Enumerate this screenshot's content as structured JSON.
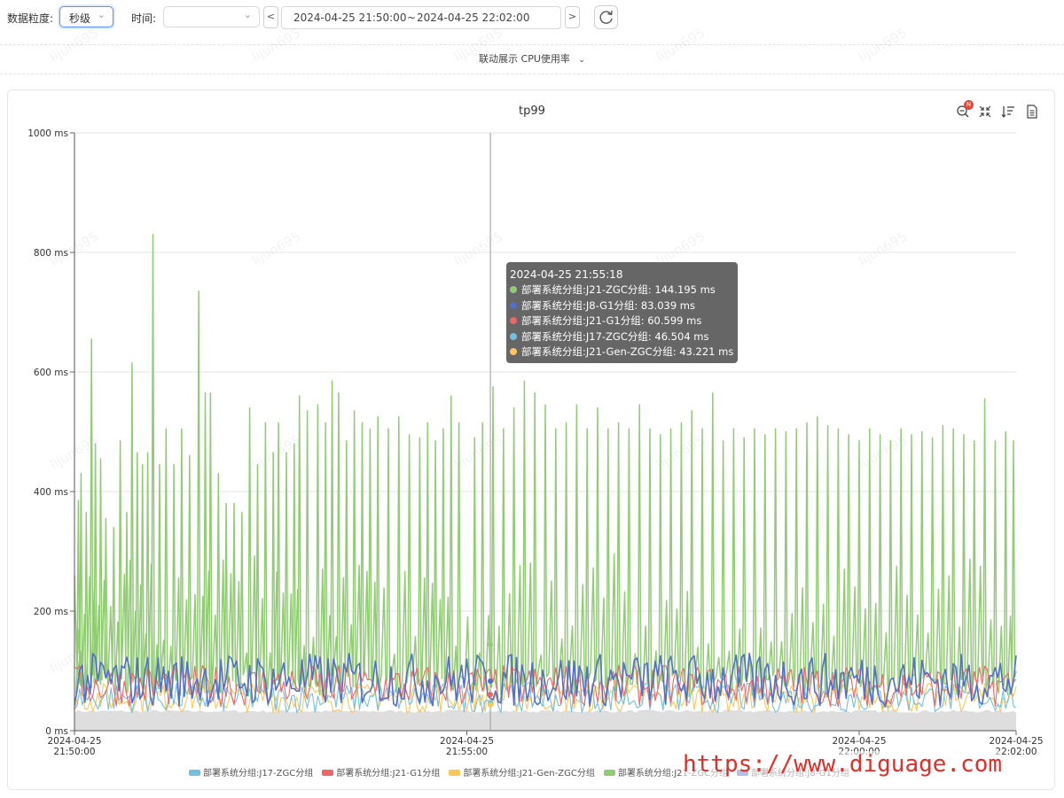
{
  "toolbar": {
    "granularity_label": "数据粒度:",
    "granularity_value": "秒级",
    "time_label": "时间:",
    "time_select_value": "",
    "prev_label": "<",
    "next_label": ">",
    "range_start": "2024-04-25 21:50:00",
    "range_sep": "~",
    "range_end": "2024-04-25 22:02:00"
  },
  "linked_toggle": {
    "label": "联动展示 CPU使用率"
  },
  "panel": {
    "title": "tp99",
    "badge": "N",
    "watermark": "lijun695"
  },
  "tooltip": {
    "time": "2024-04-25 21:55:18",
    "rows": [
      {
        "text": "部署系统分组:J21-ZGC分组: 144.195 ms",
        "color": "#91cc75"
      },
      {
        "text": "部署系统分组:J8-G1分组: 83.039 ms",
        "color": "#5470c6"
      },
      {
        "text": "部署系统分组:J21-G1分组: 60.599 ms",
        "color": "#ee6666"
      },
      {
        "text": "部署系统分组:J17-ZGC分组: 46.504 ms",
        "color": "#73c0de"
      },
      {
        "text": "部署系统分组:J21-Gen-ZGC分组: 43.221 ms",
        "color": "#fac858"
      }
    ]
  },
  "legend": [
    {
      "label": "部署系统分组:J17-ZGC分组",
      "color": "#73c0de"
    },
    {
      "label": "部署系统分组:J21-G1分组",
      "color": "#ee6666"
    },
    {
      "label": "部署系统分组:J21-Gen-ZGC分组",
      "color": "#fac858"
    },
    {
      "label": "部署系统分组:J21-ZGC分组",
      "color": "#91cc75"
    },
    {
      "label": "部署系统分组:J8-G1分组",
      "color": "#5470c6"
    }
  ],
  "site_watermark": "https://www.diguage.com",
  "chart_data": {
    "type": "line",
    "title": "tp99",
    "x_range": [
      "2024-04-25 21:50:00",
      "2024-04-25 22:02:00"
    ],
    "x_ticks": [
      {
        "date": "2024-04-25",
        "time": "21:50:00"
      },
      {
        "date": "2024-04-25",
        "time": "21:55:00"
      },
      {
        "date": "2024-04-25",
        "time": "22:00:00"
      },
      {
        "date": "2024-04-25",
        "time": "22:02:00"
      }
    ],
    "ylim": [
      0,
      1000
    ],
    "y_ticks": [
      "0 ms",
      "200 ms",
      "400 ms",
      "600 ms",
      "800 ms",
      "1000 ms"
    ],
    "y_tick_values": [
      0,
      200,
      400,
      600,
      800,
      1000
    ],
    "grid": true,
    "cursor_time": "2024-04-25 21:55:18",
    "series": [
      {
        "name": "部署系统分组:J21-ZGC分组",
        "color": "#91cc75",
        "peaks": [
          [
            "2024-04-25 21:50:03",
            385
          ],
          [
            "2024-04-25 21:50:05",
            430
          ],
          [
            "2024-04-25 21:50:09",
            365
          ],
          [
            "2024-04-25 21:50:13",
            655
          ],
          [
            "2024-04-25 21:50:16",
            480
          ],
          [
            "2024-04-25 21:50:20",
            455
          ],
          [
            "2024-04-25 21:50:24",
            355
          ],
          [
            "2024-04-25 21:50:30",
            340
          ],
          [
            "2024-04-25 21:50:35",
            485
          ],
          [
            "2024-04-25 21:50:40",
            365
          ],
          [
            "2024-04-25 21:50:44",
            615
          ],
          [
            "2024-04-25 21:50:48",
            465
          ],
          [
            "2024-04-25 21:50:52",
            445
          ],
          [
            "2024-04-25 21:50:56",
            465
          ],
          [
            "2024-04-25 21:51:00",
            830
          ],
          [
            "2024-04-25 21:51:05",
            445
          ],
          [
            "2024-04-25 21:51:10",
            505
          ],
          [
            "2024-04-25 21:51:16",
            445
          ],
          [
            "2024-04-25 21:51:22",
            505
          ],
          [
            "2024-04-25 21:51:28",
            460
          ],
          [
            "2024-04-25 21:51:35",
            735
          ],
          [
            "2024-04-25 21:51:40",
            565
          ],
          [
            "2024-04-25 21:51:44",
            565
          ],
          [
            "2024-04-25 21:51:50",
            430
          ],
          [
            "2024-04-25 21:51:56",
            380
          ],
          [
            "2024-04-25 21:52:02",
            380
          ],
          [
            "2024-04-25 21:52:08",
            365
          ],
          [
            "2024-04-25 21:52:14",
            540
          ],
          [
            "2024-04-25 21:52:20",
            445
          ],
          [
            "2024-04-25 21:52:26",
            515
          ],
          [
            "2024-04-25 21:52:32",
            465
          ],
          [
            "2024-04-25 21:52:36",
            515
          ],
          [
            "2024-04-25 21:52:42",
            465
          ],
          [
            "2024-04-25 21:52:48",
            480
          ],
          [
            "2024-04-25 21:52:52",
            560
          ],
          [
            "2024-04-25 21:52:58",
            535
          ],
          [
            "2024-04-25 21:53:06",
            545
          ],
          [
            "2024-04-25 21:53:12",
            515
          ],
          [
            "2024-04-25 21:53:17",
            585
          ],
          [
            "2024-04-25 21:53:22",
            565
          ],
          [
            "2024-04-25 21:53:28",
            485
          ],
          [
            "2024-04-25 21:53:34",
            535
          ],
          [
            "2024-04-25 21:53:40",
            515
          ],
          [
            "2024-04-25 21:53:46",
            505
          ],
          [
            "2024-04-25 21:53:52",
            525
          ],
          [
            "2024-04-25 21:54:00",
            505
          ],
          [
            "2024-04-25 21:54:08",
            525
          ],
          [
            "2024-04-25 21:54:16",
            495
          ],
          [
            "2024-04-25 21:54:24",
            490
          ],
          [
            "2024-04-25 21:54:30",
            515
          ],
          [
            "2024-04-25 21:54:36",
            485
          ],
          [
            "2024-04-25 21:54:42",
            505
          ],
          [
            "2024-04-25 21:54:48",
            560
          ],
          [
            "2024-04-25 21:54:54",
            515
          ],
          [
            "2024-04-25 21:55:06",
            490
          ],
          [
            "2024-04-25 21:55:12",
            515
          ],
          [
            "2024-04-25 21:55:20",
            575
          ],
          [
            "2024-04-25 21:55:28",
            505
          ],
          [
            "2024-04-25 21:55:36",
            540
          ],
          [
            "2024-04-25 21:55:44",
            585
          ],
          [
            "2024-04-25 21:55:52",
            565
          ],
          [
            "2024-04-25 21:56:00",
            545
          ],
          [
            "2024-04-25 21:56:08",
            505
          ],
          [
            "2024-04-25 21:56:16",
            515
          ],
          [
            "2024-04-25 21:56:24",
            545
          ],
          [
            "2024-04-25 21:56:32",
            505
          ],
          [
            "2024-04-25 21:56:40",
            540
          ],
          [
            "2024-04-25 21:56:48",
            505
          ],
          [
            "2024-04-25 21:56:56",
            515
          ],
          [
            "2024-04-25 21:57:04",
            505
          ],
          [
            "2024-04-25 21:57:12",
            545
          ],
          [
            "2024-04-25 21:57:20",
            505
          ],
          [
            "2024-04-25 21:57:28",
            495
          ],
          [
            "2024-04-25 21:57:36",
            505
          ],
          [
            "2024-04-25 21:57:44",
            515
          ],
          [
            "2024-04-25 21:57:52",
            535
          ],
          [
            "2024-04-25 21:58:00",
            505
          ],
          [
            "2024-04-25 21:58:08",
            565
          ],
          [
            "2024-04-25 21:58:16",
            485
          ],
          [
            "2024-04-25 21:58:24",
            505
          ],
          [
            "2024-04-25 21:58:32",
            490
          ],
          [
            "2024-04-25 21:58:40",
            505
          ],
          [
            "2024-04-25 21:58:48",
            495
          ],
          [
            "2024-04-25 21:58:56",
            505
          ],
          [
            "2024-04-25 21:59:04",
            500
          ],
          [
            "2024-04-25 21:59:12",
            505
          ],
          [
            "2024-04-25 21:59:20",
            515
          ],
          [
            "2024-04-25 21:59:28",
            525
          ],
          [
            "2024-04-25 21:59:36",
            510
          ],
          [
            "2024-04-25 21:59:44",
            505
          ],
          [
            "2024-04-25 21:59:52",
            495
          ],
          [
            "2024-04-25 22:00:00",
            485
          ],
          [
            "2024-04-25 22:00:08",
            505
          ],
          [
            "2024-04-25 22:00:16",
            495
          ],
          [
            "2024-04-25 22:00:24",
            485
          ],
          [
            "2024-04-25 22:00:32",
            505
          ],
          [
            "2024-04-25 22:00:40",
            495
          ],
          [
            "2024-04-25 22:00:48",
            500
          ],
          [
            "2024-04-25 22:00:56",
            490
          ],
          [
            "2024-04-25 22:01:04",
            510
          ],
          [
            "2024-04-25 22:01:12",
            505
          ],
          [
            "2024-04-25 22:01:20",
            495
          ],
          [
            "2024-04-25 22:01:28",
            485
          ],
          [
            "2024-04-25 22:01:36",
            555
          ],
          [
            "2024-04-25 22:01:44",
            485
          ],
          [
            "2024-04-25 22:01:52",
            500
          ],
          [
            "2024-04-25 22:01:58",
            485
          ]
        ]
      },
      {
        "name": "部署系统分组:J8-G1分组",
        "color": "#5470c6",
        "typical_range": [
          40,
          130
        ]
      },
      {
        "name": "部署系统分组:J21-G1分组",
        "color": "#ee6666",
        "typical_range": [
          40,
          110
        ]
      },
      {
        "name": "部署系统分组:J17-ZGC分组",
        "color": "#73c0de",
        "typical_range": [
          30,
          80
        ]
      },
      {
        "name": "部署系统分组:J21-Gen-ZGC分组",
        "color": "#fac858",
        "typical_range": [
          30,
          80
        ]
      }
    ]
  }
}
